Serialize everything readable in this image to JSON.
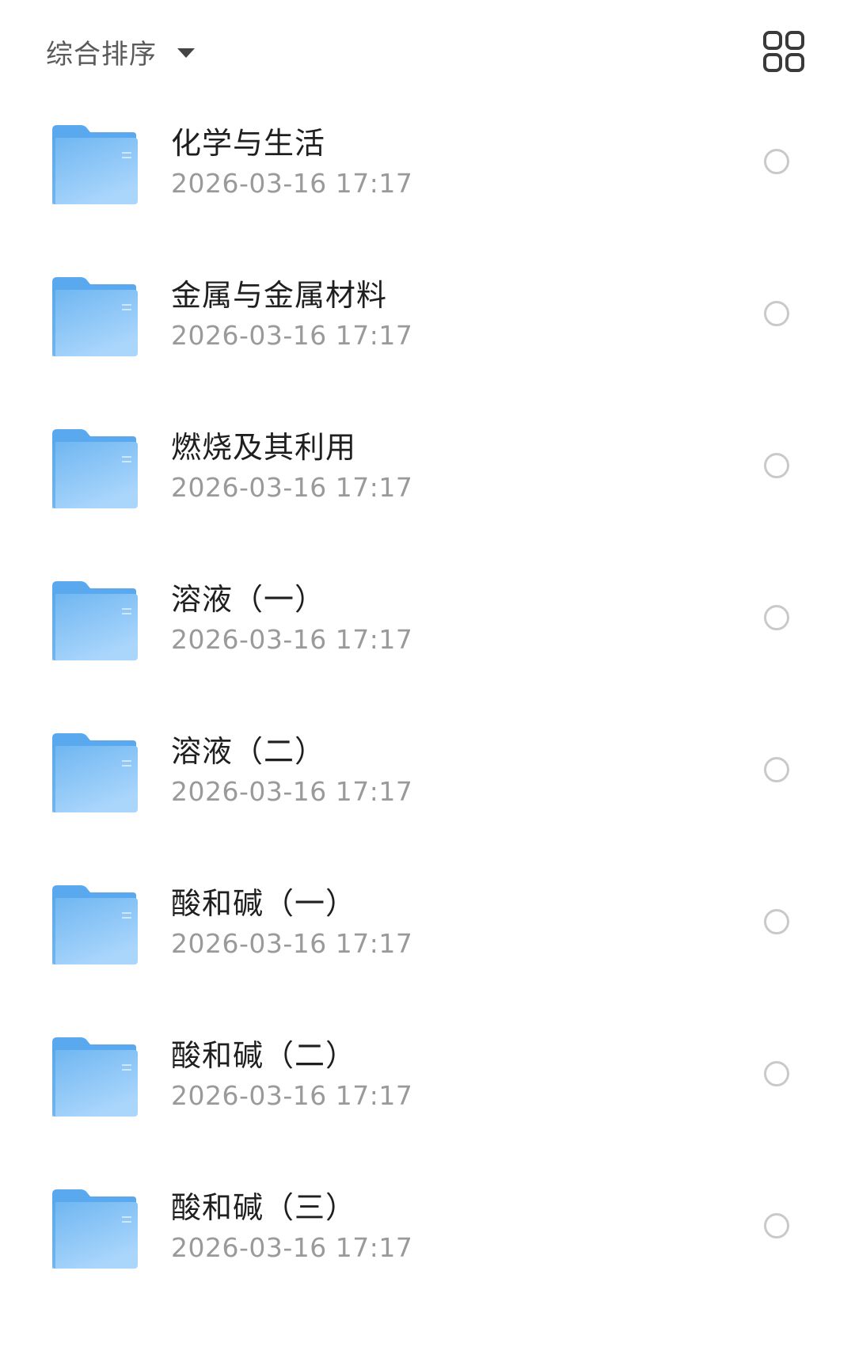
{
  "header": {
    "sort_label": "综合排序",
    "sort_caret_icon": "caret-down-icon",
    "view_toggle_icon": "grid-view-icon"
  },
  "colors": {
    "folder_tab": "#5aa9ee",
    "folder_body_top": "#6fb6f1",
    "folder_body_bottom": "#a9d5fb",
    "name_text": "#1f1f1f",
    "date_text": "#9a9a9a",
    "radio_border": "#c9c9c9"
  },
  "files": [
    {
      "name": "化学与生活",
      "date": "2026-03-16 17:17"
    },
    {
      "name": "金属与金属材料",
      "date": "2026-03-16 17:17"
    },
    {
      "name": "燃烧及其利用",
      "date": "2026-03-16 17:17"
    },
    {
      "name": "溶液（一）",
      "date": "2026-03-16 17:17"
    },
    {
      "name": "溶液（二）",
      "date": "2026-03-16 17:17"
    },
    {
      "name": "酸和碱（一）",
      "date": "2026-03-16 17:17"
    },
    {
      "name": "酸和碱（二）",
      "date": "2026-03-16 17:17"
    },
    {
      "name": "酸和碱（三）",
      "date": "2026-03-16 17:17"
    }
  ]
}
